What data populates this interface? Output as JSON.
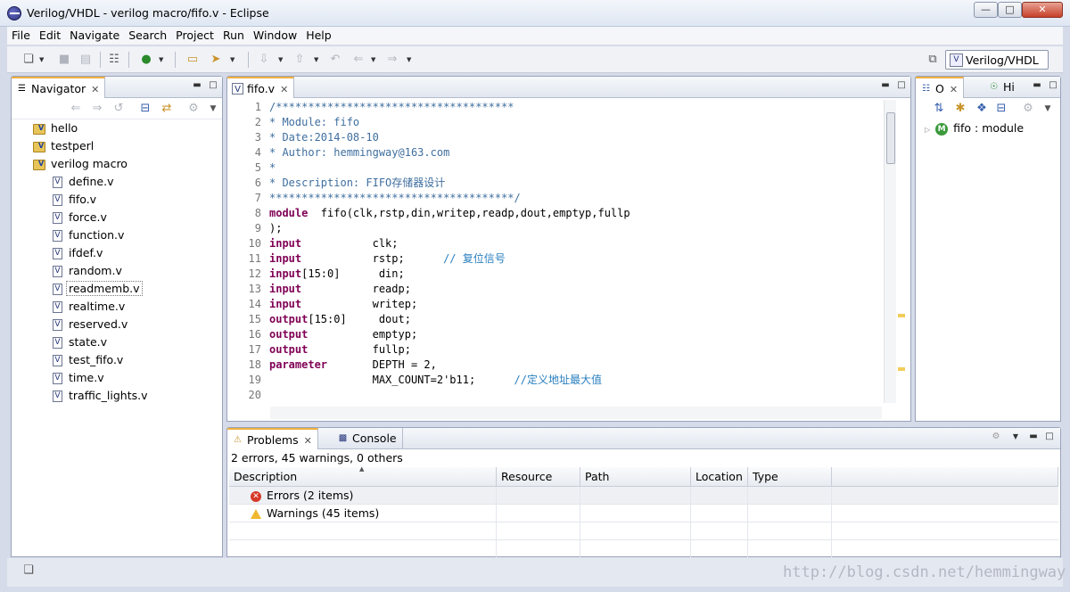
{
  "window": {
    "title": "Verilog/VHDL - verilog macro/fifo.v - Eclipse"
  },
  "menu": [
    "File",
    "Edit",
    "Navigate",
    "Search",
    "Project",
    "Run",
    "Window",
    "Help"
  ],
  "perspective": {
    "label": "Verilog/VHDL"
  },
  "navigator": {
    "tab": "Navigator",
    "projects": [
      "hello",
      "testperl",
      "verilog macro"
    ],
    "files": [
      "define.v",
      "fifo.v",
      "force.v",
      "function.v",
      "ifdef.v",
      "random.v",
      "readmemb.v",
      "realtime.v",
      "reserved.v",
      "state.v",
      "test_fifo.v",
      "time.v",
      "traffic_lights.v"
    ]
  },
  "editor": {
    "tab": "fifo.v",
    "lines": [
      {
        "n": "1",
        "parts": [
          {
            "t": "/*************************************",
            "c": "cm"
          }
        ]
      },
      {
        "n": "2",
        "parts": [
          {
            "t": "* Module: fifo",
            "c": "cm"
          }
        ]
      },
      {
        "n": "3",
        "parts": [
          {
            "t": "* Date:2014-08-10",
            "c": "cm"
          }
        ]
      },
      {
        "n": "4",
        "parts": [
          {
            "t": "* Author: hemmingway@163.com",
            "c": "cm"
          }
        ]
      },
      {
        "n": "5",
        "parts": [
          {
            "t": "*",
            "c": "cm"
          }
        ]
      },
      {
        "n": "6",
        "parts": [
          {
            "t": "* Description: FIFO存储器设计",
            "c": "cm"
          }
        ]
      },
      {
        "n": "7",
        "parts": [
          {
            "t": "**************************************/",
            "c": "cm"
          }
        ]
      },
      {
        "n": "8",
        "parts": [
          {
            "t": "module",
            "c": "kw"
          },
          {
            "t": "  fifo(clk,rstp,din,writep,readp,dout,emptyp,fullp",
            "c": ""
          }
        ]
      },
      {
        "n": "9",
        "parts": [
          {
            "t": ");",
            "c": ""
          }
        ]
      },
      {
        "n": "10",
        "parts": [
          {
            "t": "input",
            "c": "kw"
          },
          {
            "t": "           clk;",
            "c": ""
          }
        ]
      },
      {
        "n": "11",
        "parts": [
          {
            "t": "input",
            "c": "kw"
          },
          {
            "t": "           rstp;      ",
            "c": ""
          },
          {
            "t": "// 复位信号",
            "c": "ccm"
          }
        ]
      },
      {
        "n": "12",
        "parts": [
          {
            "t": "input",
            "c": "kw"
          },
          {
            "t": "[15:0]      din;",
            "c": ""
          }
        ]
      },
      {
        "n": "13",
        "parts": [
          {
            "t": "input",
            "c": "kw"
          },
          {
            "t": "           readp;",
            "c": ""
          }
        ]
      },
      {
        "n": "14",
        "parts": [
          {
            "t": "input",
            "c": "kw"
          },
          {
            "t": "           writep;",
            "c": ""
          }
        ]
      },
      {
        "n": "15",
        "parts": [
          {
            "t": "output",
            "c": "kw"
          },
          {
            "t": "[15:0]     dout;",
            "c": ""
          }
        ]
      },
      {
        "n": "16",
        "parts": [
          {
            "t": "output",
            "c": "kw"
          },
          {
            "t": "          emptyp;",
            "c": ""
          }
        ]
      },
      {
        "n": "17",
        "parts": [
          {
            "t": "output",
            "c": "kw"
          },
          {
            "t": "          fullp;",
            "c": ""
          }
        ]
      },
      {
        "n": "18",
        "parts": [
          {
            "t": "parameter",
            "c": "kw"
          },
          {
            "t": "       DEPTH = 2,",
            "c": ""
          }
        ]
      },
      {
        "n": "19",
        "parts": [
          {
            "t": "                MAX_COUNT=2'b11;      ",
            "c": ""
          },
          {
            "t": "//定义地址最大值",
            "c": "ccm"
          }
        ]
      },
      {
        "n": "20",
        "parts": [
          {
            "t": "",
            "c": ""
          }
        ]
      }
    ]
  },
  "outline": {
    "tab1": "O",
    "tab2": "Hi",
    "item": "fifo : module"
  },
  "bottom": {
    "tab_problems": "Problems",
    "tab_console": "Console",
    "summary": "2 errors, 45 warnings, 0 others",
    "columns": [
      "Description",
      "Resource",
      "Path",
      "Location",
      "Type"
    ],
    "rows": [
      {
        "label": "Errors (2 items)",
        "kind": "error"
      },
      {
        "label": "Warnings (45 items)",
        "kind": "warning"
      }
    ]
  },
  "watermark": "http://blog.csdn.net/hemmingway"
}
